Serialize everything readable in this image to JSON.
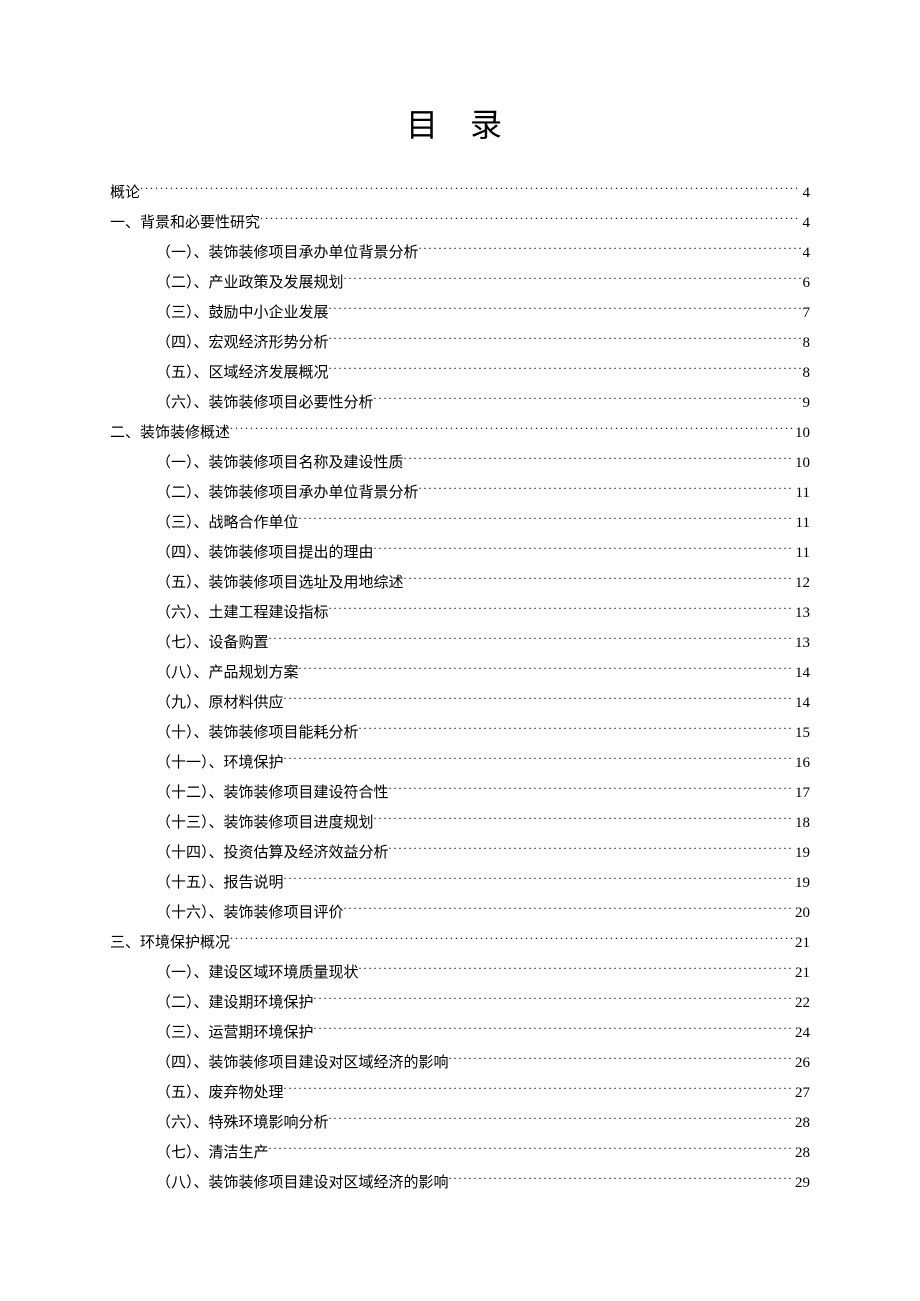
{
  "title": "目 录",
  "toc": [
    {
      "level": 0,
      "label": "概论",
      "page": "4"
    },
    {
      "level": 0,
      "label": "一、背景和必要性研究",
      "page": "4"
    },
    {
      "level": 1,
      "label": "（一）、装饰装修项目承办单位背景分析",
      "page": "4"
    },
    {
      "level": 1,
      "label": "（二）、产业政策及发展规划",
      "page": "6"
    },
    {
      "level": 1,
      "label": "（三）、鼓励中小企业发展",
      "page": "7"
    },
    {
      "level": 1,
      "label": "（四）、宏观经济形势分析",
      "page": "8"
    },
    {
      "level": 1,
      "label": "（五）、区域经济发展概况",
      "page": "8"
    },
    {
      "level": 1,
      "label": "（六）、装饰装修项目必要性分析",
      "page": "9"
    },
    {
      "level": 0,
      "label": "二、装饰装修概述",
      "page": "10"
    },
    {
      "level": 1,
      "label": "（一）、装饰装修项目名称及建设性质",
      "page": "10"
    },
    {
      "level": 1,
      "label": "（二）、装饰装修项目承办单位背景分析",
      "page": "11"
    },
    {
      "level": 1,
      "label": "（三）、战略合作单位",
      "page": "11"
    },
    {
      "level": 1,
      "label": "（四）、装饰装修项目提出的理由",
      "page": "11"
    },
    {
      "level": 1,
      "label": "（五）、装饰装修项目选址及用地综述",
      "page": "12"
    },
    {
      "level": 1,
      "label": "（六）、土建工程建设指标",
      "page": "13"
    },
    {
      "level": 1,
      "label": "（七）、设备购置",
      "page": "13"
    },
    {
      "level": 1,
      "label": "（八）、产品规划方案",
      "page": "14"
    },
    {
      "level": 1,
      "label": "（九）、原材料供应",
      "page": "14"
    },
    {
      "level": 1,
      "label": "（十）、装饰装修项目能耗分析",
      "page": "15"
    },
    {
      "level": 1,
      "label": "（十一）、环境保护",
      "page": "16"
    },
    {
      "level": 1,
      "label": "（十二）、装饰装修项目建设符合性",
      "page": "17"
    },
    {
      "level": 1,
      "label": "（十三）、装饰装修项目进度规划",
      "page": "18"
    },
    {
      "level": 1,
      "label": "（十四）、投资估算及经济效益分析",
      "page": "19"
    },
    {
      "level": 1,
      "label": "（十五）、报告说明",
      "page": "19"
    },
    {
      "level": 1,
      "label": "（十六）、装饰装修项目评价",
      "page": "20"
    },
    {
      "level": 0,
      "label": "三、环境保护概况",
      "page": "21"
    },
    {
      "level": 1,
      "label": "（一）、建设区域环境质量现状",
      "page": "21"
    },
    {
      "level": 1,
      "label": "（二）、建设期环境保护",
      "page": "22"
    },
    {
      "level": 1,
      "label": "（三）、运营期环境保护",
      "page": "24"
    },
    {
      "level": 1,
      "label": "（四）、装饰装修项目建设对区域经济的影响",
      "page": "26"
    },
    {
      "level": 1,
      "label": "（五）、废弃物处理",
      "page": "27"
    },
    {
      "level": 1,
      "label": "（六）、特殊环境影响分析",
      "page": "28"
    },
    {
      "level": 1,
      "label": "（七）、清洁生产",
      "page": "28"
    },
    {
      "level": 1,
      "label": "（八）、装饰装修项目建设对区域经济的影响",
      "page": "29"
    }
  ]
}
